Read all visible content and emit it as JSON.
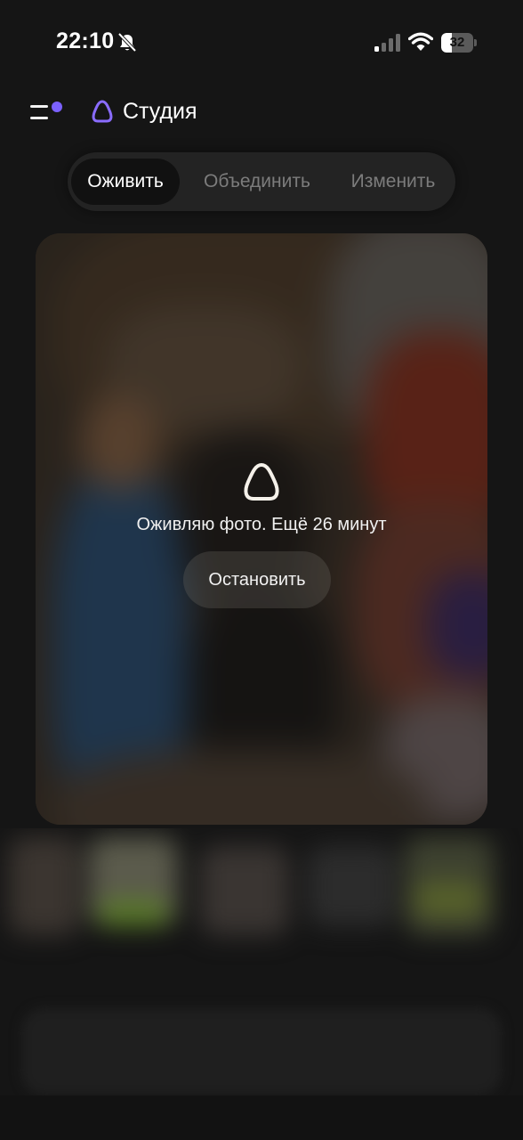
{
  "status_bar": {
    "time": "22:10",
    "battery": "32",
    "battery_level": 0.32,
    "icons": [
      "bell-muted-icon",
      "cellular-signal-icon",
      "wifi-icon",
      "battery-icon"
    ]
  },
  "header": {
    "title": "Студия",
    "menu_icon": "menu-icon",
    "brand_icon": "alice-logo-icon",
    "accent_color": "#7b61ff"
  },
  "tabs": [
    {
      "label": "Оживить",
      "active": true
    },
    {
      "label": "Объединить",
      "active": false
    },
    {
      "label": "Изменить",
      "active": false
    }
  ],
  "processing": {
    "message": "Оживляю фото. Ещё 26 минут",
    "stop_label": "Остановить"
  }
}
